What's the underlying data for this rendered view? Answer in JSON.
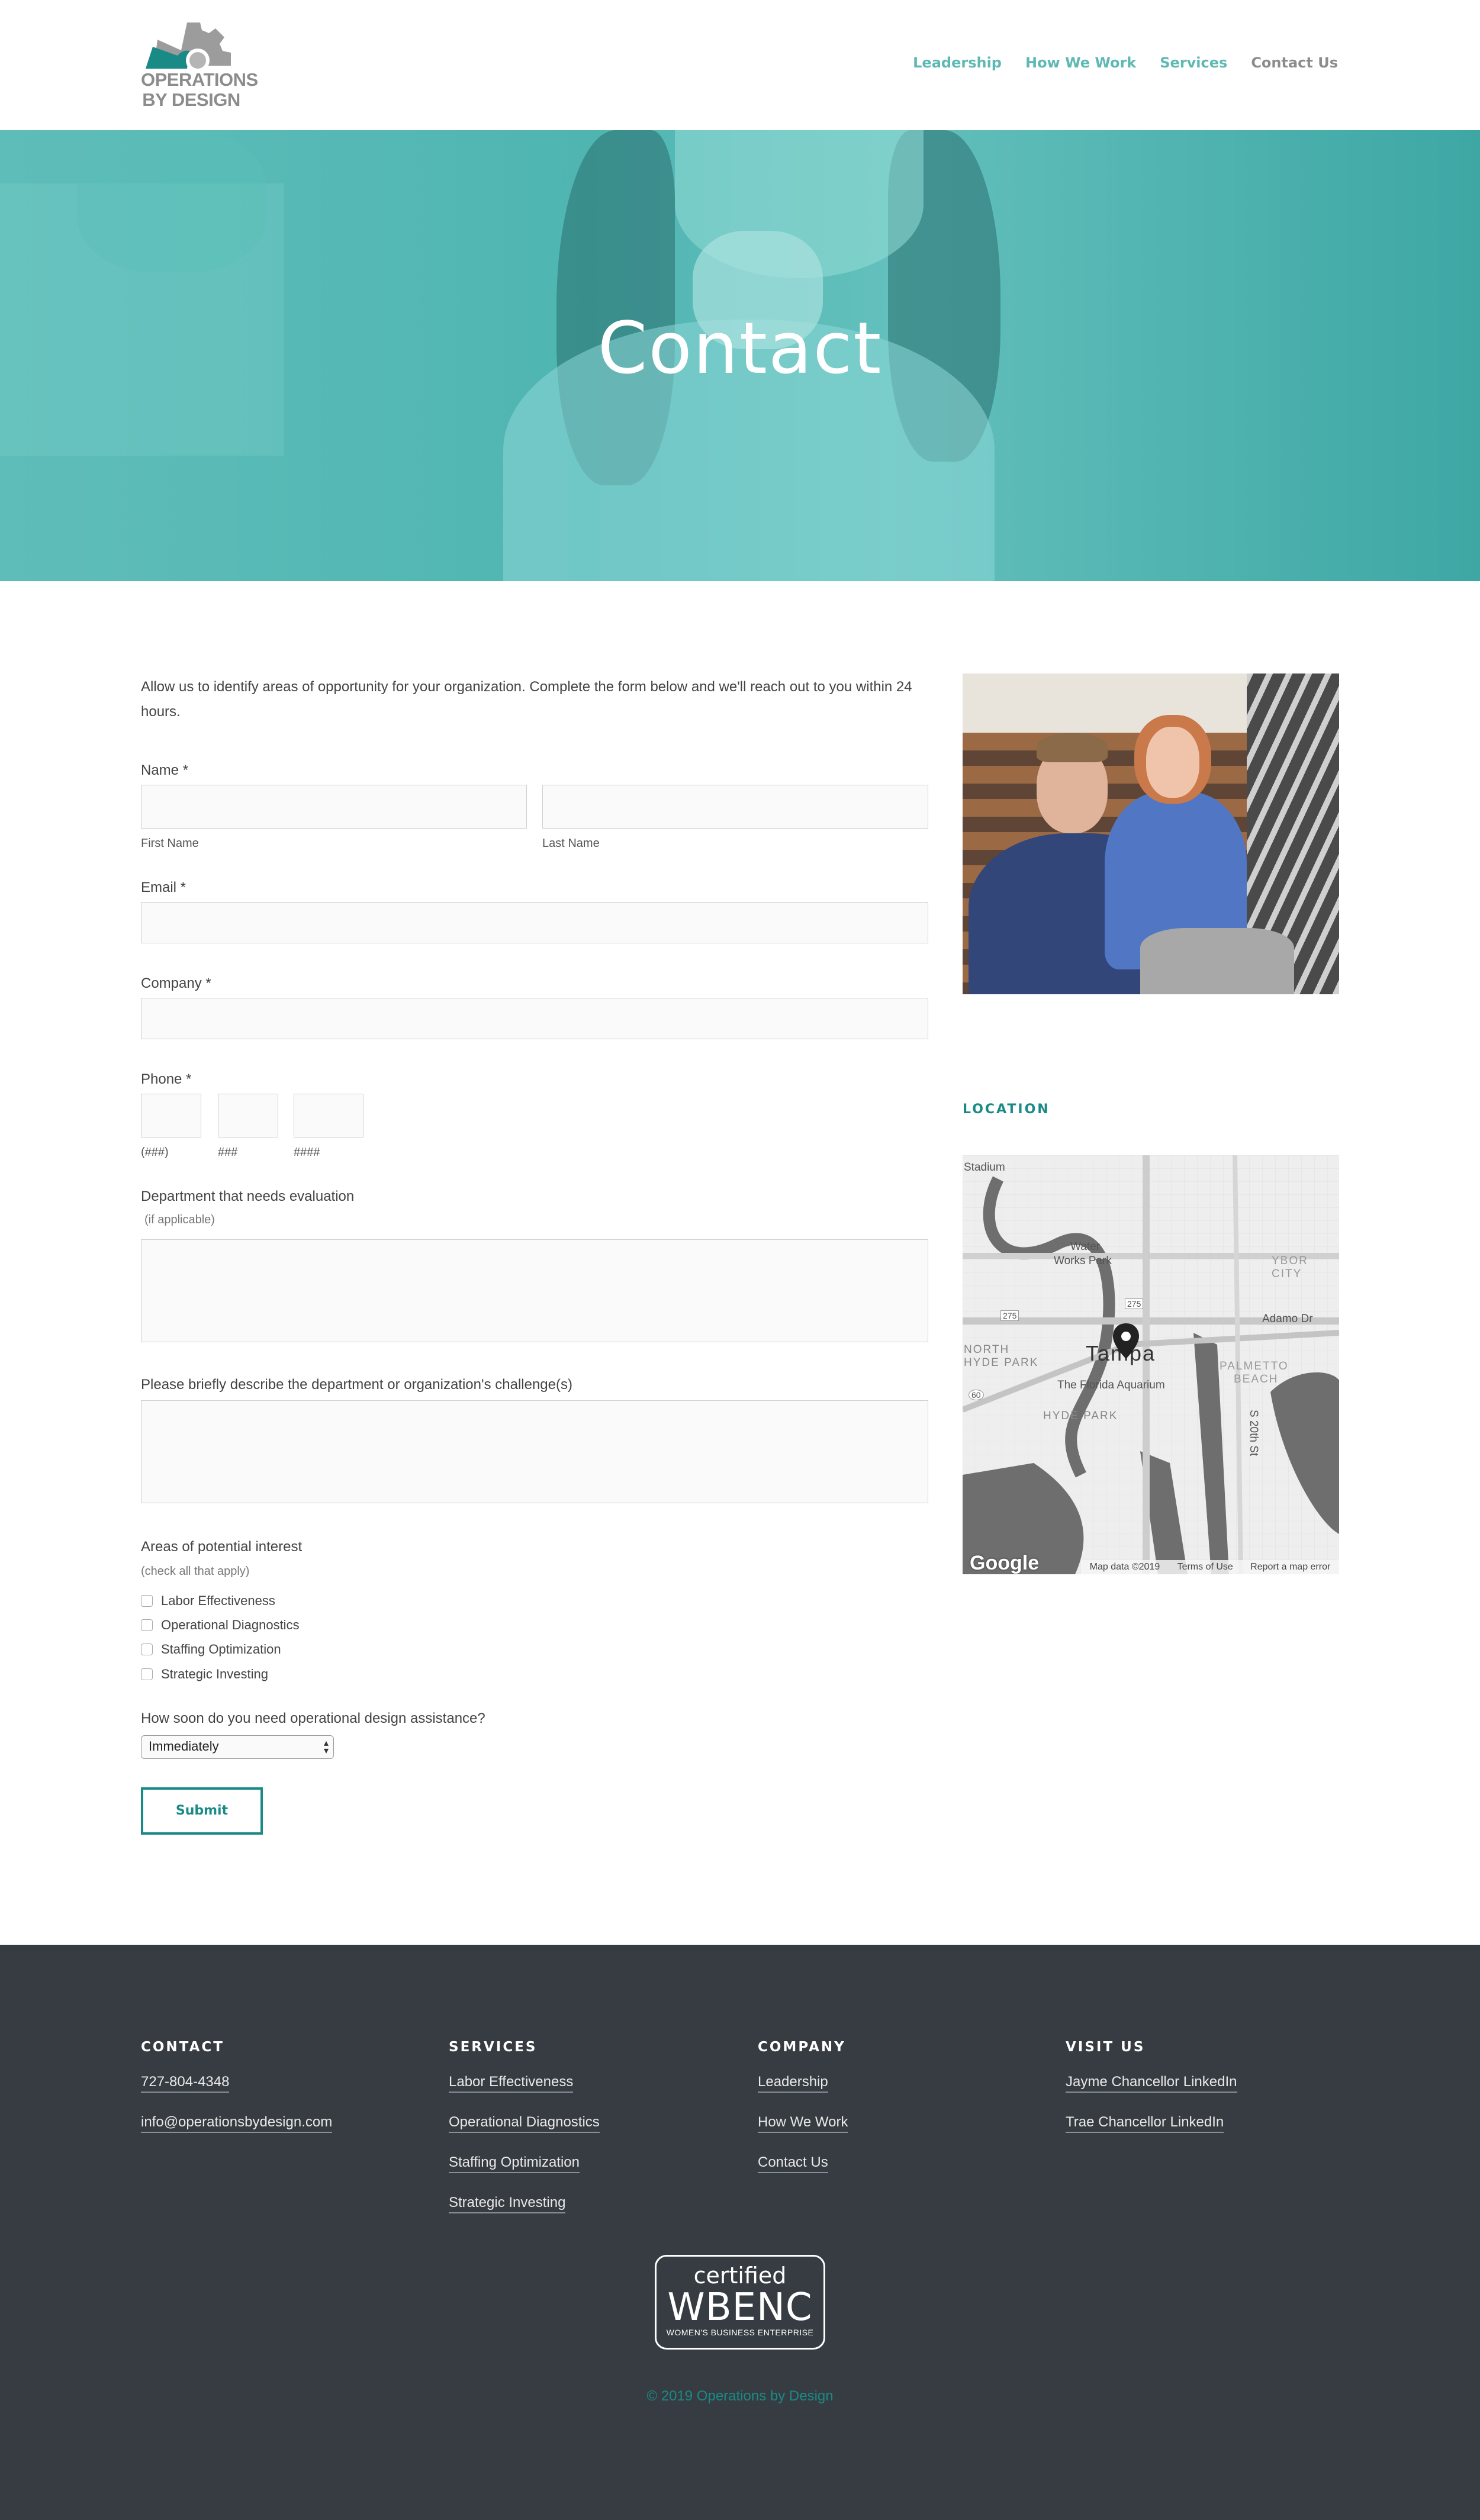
{
  "brand": {
    "logo_line1": "OPERATIONS",
    "logo_line2": "BY DESIGN",
    "teal": "#1a8a86",
    "nav_teal": "#5eb8b3",
    "gray": "#8c8c8c"
  },
  "nav": {
    "items": [
      {
        "label": "Leadership"
      },
      {
        "label": "How We Work"
      },
      {
        "label": "Services"
      },
      {
        "label": "Contact Us"
      }
    ]
  },
  "hero": {
    "title": "Contact"
  },
  "form": {
    "intro": "Allow us to identify areas of opportunity for your organization. Complete the form below and we'll reach out to you within 24 hours.",
    "name_label": "Name *",
    "first_name_label": "First Name",
    "last_name_label": "Last Name",
    "email_label": "Email *",
    "company_label": "Company *",
    "phone_label": "Phone *",
    "phone_parts": [
      "(###)",
      "###",
      "####"
    ],
    "department_label": "Department that needs evaluation",
    "department_hint": "(if applicable)",
    "challenge_label": "Please briefly describe the department or organization's challenge(s)",
    "interest_label": "Areas of potential interest",
    "interest_hint": "(check all that apply)",
    "interests": [
      {
        "label": "Labor Effectiveness"
      },
      {
        "label": "Operational Diagnostics"
      },
      {
        "label": "Staffing Optimization"
      },
      {
        "label": "Strategic Investing"
      }
    ],
    "timing_label": "How soon do you need operational design assistance?",
    "timing_value": "Immediately",
    "submit_label": "Submit"
  },
  "sidebar": {
    "location_title": "LOCATION",
    "map": {
      "labels": {
        "stadium": "Stadium",
        "water1": "Water",
        "water2": "Works Park",
        "north1": "NORTH",
        "north2": "HYDE PARK",
        "hyde": "HYDE PARK",
        "tampa": "Tampa",
        "aquarium": "The Florida Aquarium",
        "ybor": "YBOR CITY",
        "adamo": "Adamo Dr",
        "palmetto1": "PALMETTO",
        "palmetto2": "BEACH",
        "s20": "S 20th St",
        "shield275a": "275",
        "shield275b": "275",
        "shield60": "60"
      },
      "google": "Google",
      "map_data": "Map data ©2019",
      "terms": "Terms of Use",
      "report": "Report a map error"
    }
  },
  "footer": {
    "contact": {
      "title": "CONTACT",
      "links": [
        {
          "label": "727-804-4348"
        },
        {
          "label": "info@operationsbydesign.com"
        }
      ]
    },
    "services": {
      "title": "SERVICES",
      "links": [
        {
          "label": "Labor Effectiveness"
        },
        {
          "label": "Operational Diagnostics"
        },
        {
          "label": "Staffing Optimization"
        },
        {
          "label": "Strategic Investing"
        }
      ]
    },
    "company": {
      "title": "COMPANY",
      "links": [
        {
          "label": "Leadership"
        },
        {
          "label": "How We Work"
        },
        {
          "label": "Contact Us"
        }
      ]
    },
    "visit": {
      "title": "VISIT US",
      "links": [
        {
          "label": "Jayme Chancellor LinkedIn"
        },
        {
          "label": "Trae Chancellor LinkedIn"
        }
      ]
    },
    "badge": {
      "line1": "certified",
      "line2": "WBENC",
      "line3": "WOMEN'S BUSINESS ENTERPRISE"
    },
    "copyright": "© 2019 Operations by Design"
  }
}
